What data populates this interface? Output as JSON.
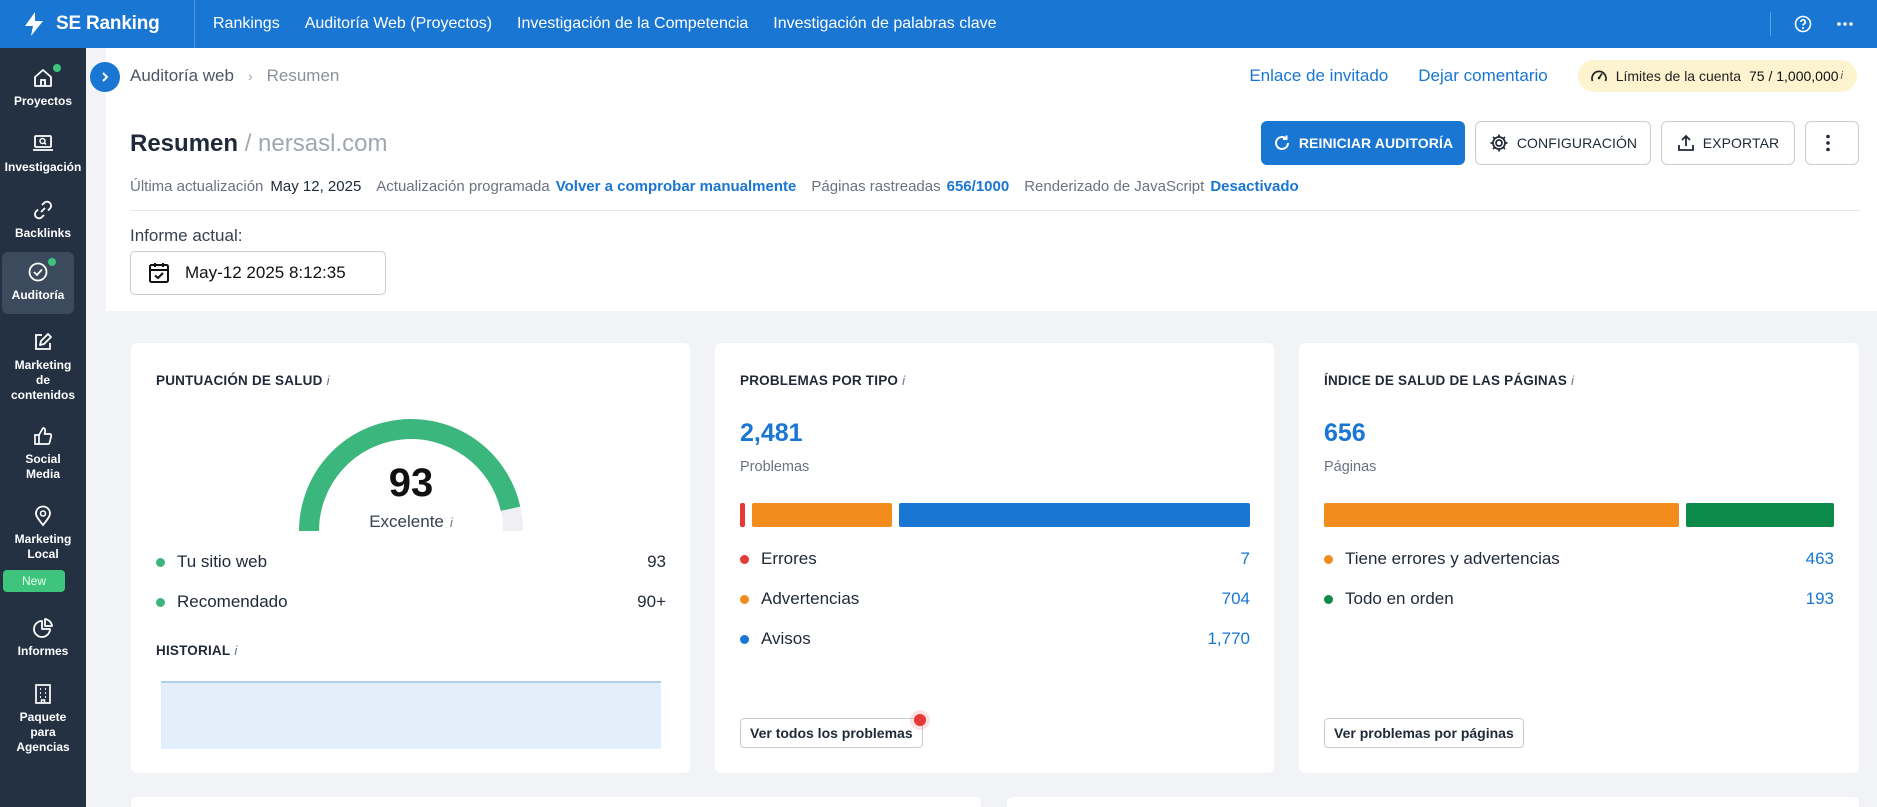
{
  "topbar": {
    "brand": "SE Ranking",
    "nav": [
      "Rankings",
      "Auditoría Web (Proyectos)",
      "Investigación de la Competencia",
      "Investigación de palabras clave"
    ]
  },
  "sidebar": {
    "items": [
      {
        "label": "Proyectos",
        "icon": "home-icon",
        "dot": true
      },
      {
        "label": "Investigación",
        "icon": "laptop-search-icon",
        "dot": false
      },
      {
        "label": "Backlinks",
        "icon": "link-icon",
        "dot": false
      },
      {
        "label": "Auditoría",
        "icon": "check-circle-icon",
        "dot": true,
        "active": true
      },
      {
        "label": "Marketing\nde\ncontenidos",
        "icon": "edit-icon",
        "dot": false
      },
      {
        "label": "Social\nMedia",
        "icon": "thumbs-up-icon",
        "dot": false
      },
      {
        "label": "Marketing\nLocal",
        "icon": "map-pin-icon",
        "dot": false
      },
      {
        "label": "Informes",
        "icon": "pie-chart-icon",
        "dot": false
      },
      {
        "label": "Paquete\npara\nAgencias",
        "icon": "building-icon",
        "dot": false
      }
    ],
    "new_badge": "New"
  },
  "header": {
    "breadcrumb": [
      "Auditoría web",
      "Resumen"
    ],
    "invite_link": "Enlace de invitado",
    "feedback_link": "Dejar comentario",
    "limits_label": "Límites de la cuenta",
    "limits_value": "75 / 1,000,000",
    "limits_info": "i",
    "title": "Resumen",
    "domain": "/ nersasl.com",
    "btn_restart": "REINICIAR AUDITORÍA",
    "btn_config": "CONFIGURACIÓN",
    "btn_export": "EXPORTAR"
  },
  "meta": {
    "last_update_label": "Última actualización",
    "last_update_value": "May 12, 2025",
    "scheduled_label": "Actualización programada",
    "scheduled_value": "Volver a comprobar manualmente",
    "crawled_label": "Páginas rastreadas",
    "crawled_value": "656/1000",
    "js_label": "Renderizado de JavaScript",
    "js_value": "Desactivado"
  },
  "report": {
    "label": "Informe actual:",
    "date": "May-12 2025 8:12:35"
  },
  "health": {
    "title": "PUNTUACIÓN DE SALUD",
    "info": "i",
    "score": "93",
    "score_fraction": 0.93,
    "rating": "Excelente",
    "rows": [
      {
        "label": "Tu sitio web",
        "value": "93",
        "color": "#3bb77e"
      },
      {
        "label": "Recomendado",
        "value": "90+",
        "color": "#3bb77e"
      }
    ],
    "history_title": "HISTORIAL"
  },
  "issues": {
    "title": "PROBLEMAS POR TIPO",
    "info": "i",
    "total": "2,481",
    "total_label": "Problemas",
    "segments": [
      {
        "label": "Errores",
        "value": 7,
        "display": "7",
        "color": "#e53935"
      },
      {
        "label": "Advertencias",
        "value": 704,
        "display": "704",
        "color": "#f28c1c"
      },
      {
        "label": "Avisos",
        "value": 1770,
        "display": "1,770",
        "color": "#1976d2"
      }
    ],
    "button": "Ver todos los problemas"
  },
  "pages": {
    "title": "ÍNDICE DE SALUD DE LAS PÁGINAS",
    "info": "i",
    "total": "656",
    "total_label": "Páginas",
    "segments": [
      {
        "label": "Tiene errores y advertencias",
        "value": 463,
        "display": "463",
        "color": "#f28c1c"
      },
      {
        "label": "Todo en orden",
        "value": 193,
        "display": "193",
        "color": "#0b8a4a"
      }
    ],
    "button": "Ver problemas por páginas"
  },
  "colors": {
    "brand": "#1976d2",
    "sidebar": "#233142",
    "success": "#3bb77e"
  }
}
